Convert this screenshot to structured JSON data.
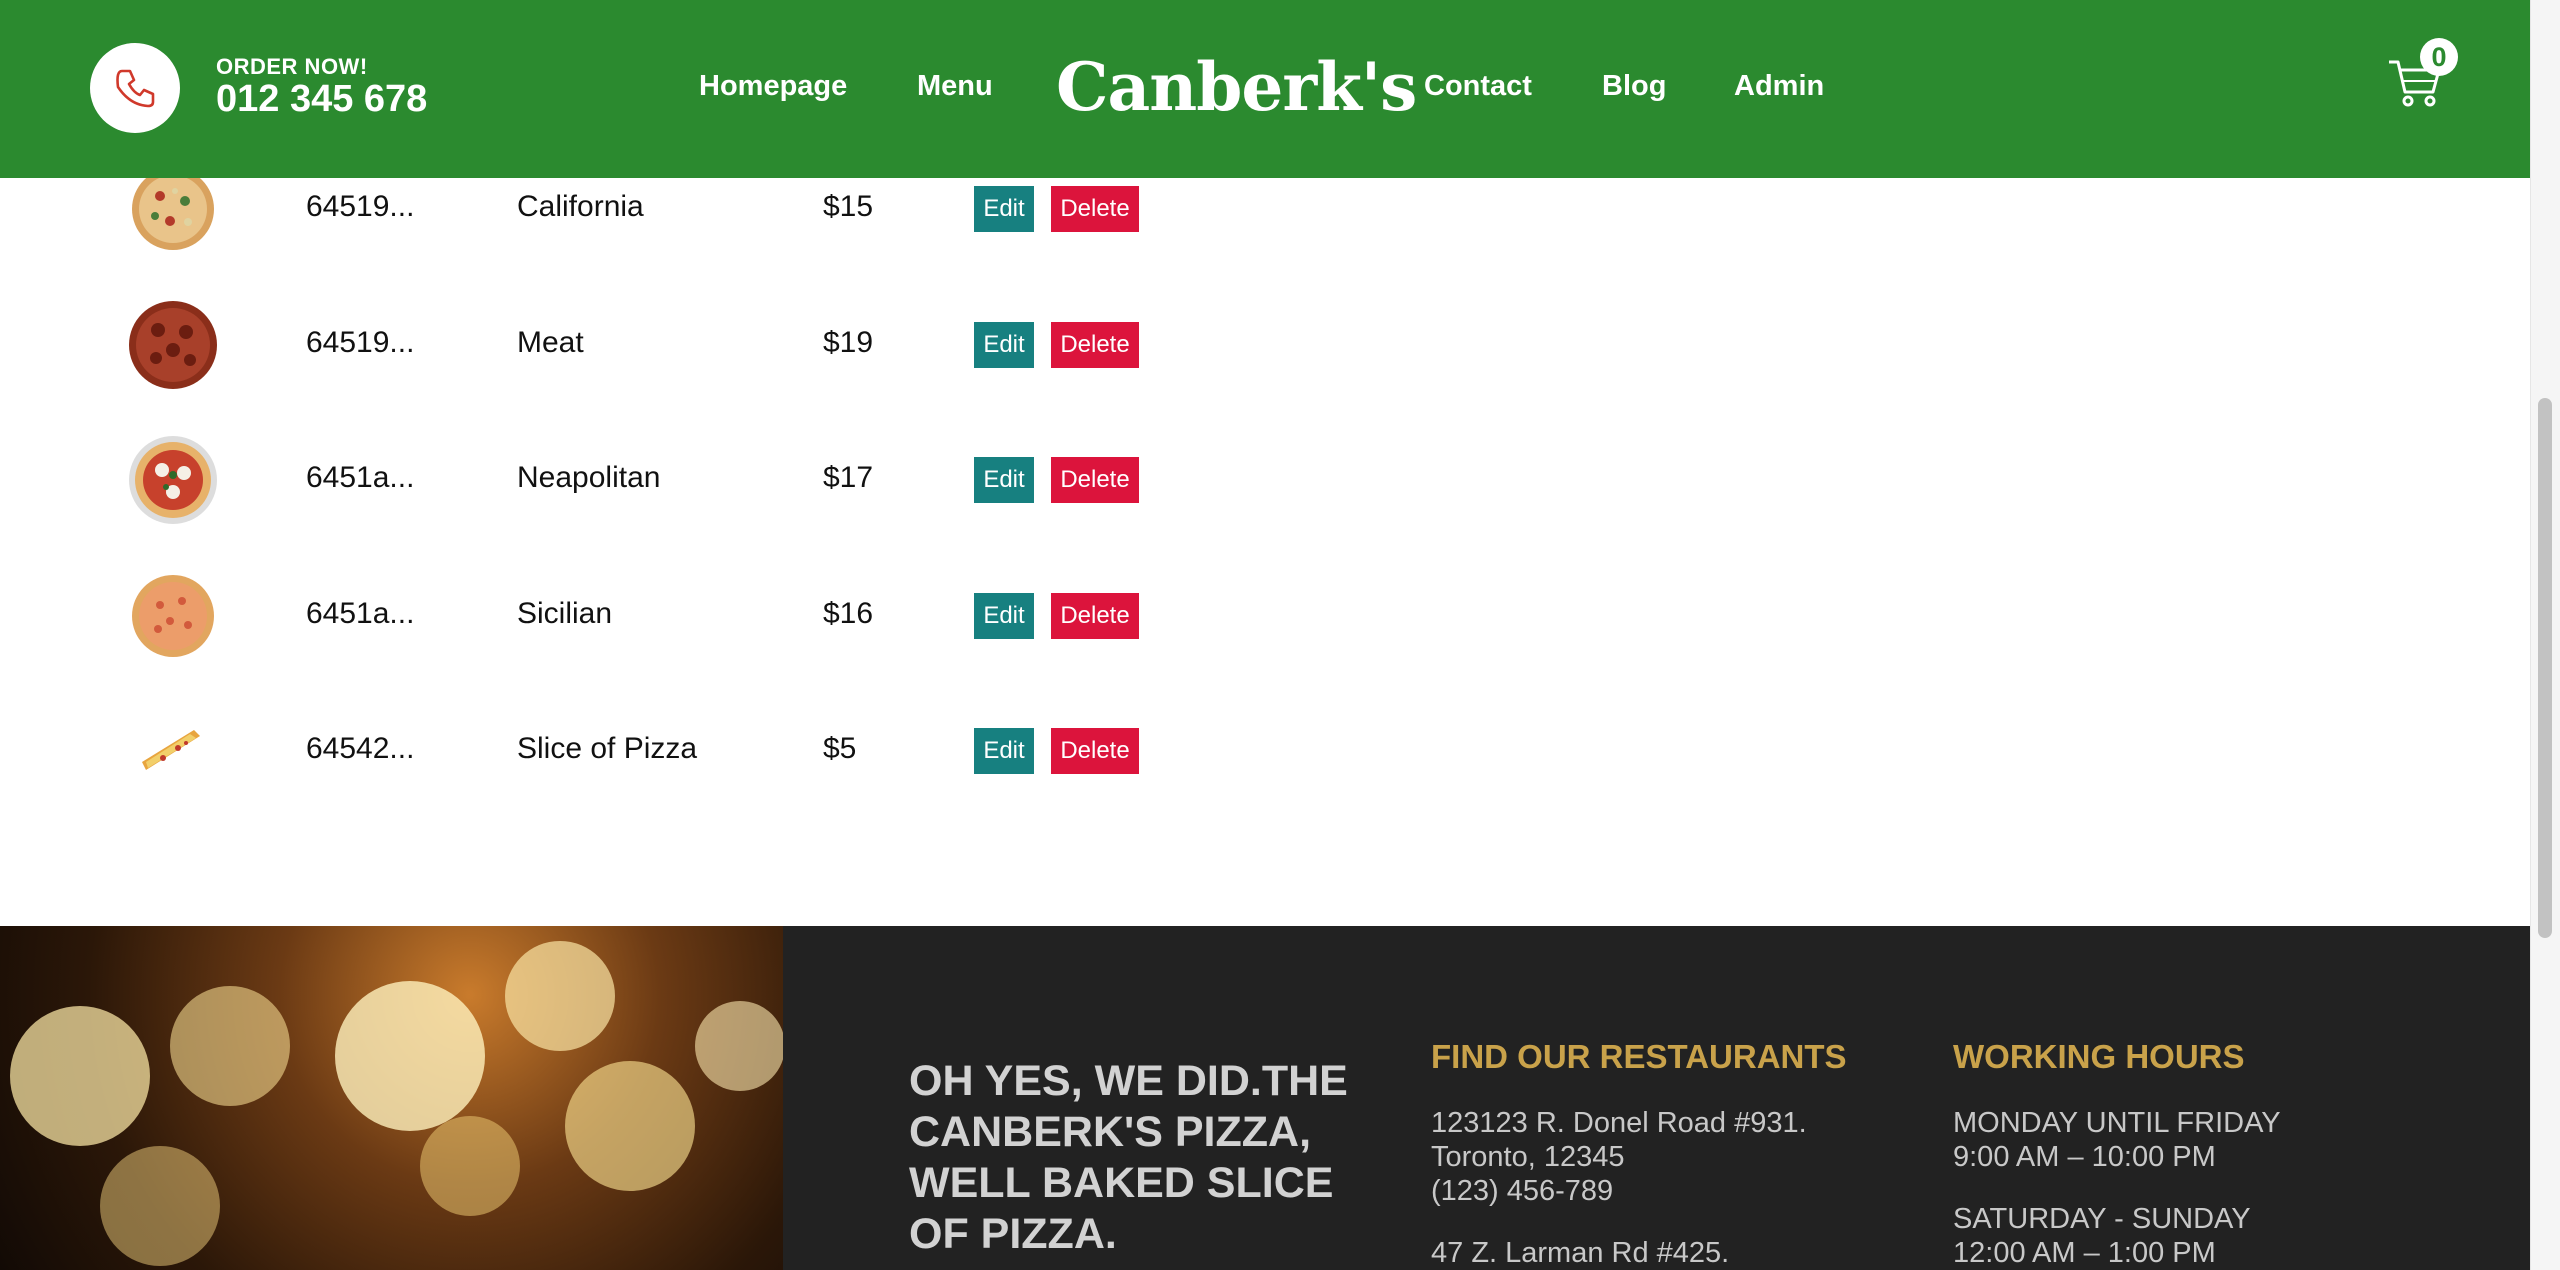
{
  "nav": {
    "order_label": "ORDER NOW!",
    "phone": "012 345 678",
    "brand": "Canberk's",
    "links": [
      "Homepage",
      "Menu",
      "Contact",
      "Blog",
      "Admin"
    ],
    "cart_count": "0",
    "phone_icon": "phone-icon",
    "cart_icon": "cart-icon"
  },
  "products": [
    {
      "id": "64519...",
      "name": "California",
      "price": "$15",
      "edit": "Edit",
      "delete": "Delete",
      "image": "pizza-california"
    },
    {
      "id": "64519...",
      "name": "Meat",
      "price": "$19",
      "edit": "Edit",
      "delete": "Delete",
      "image": "pizza-meat"
    },
    {
      "id": "6451a...",
      "name": "Neapolitan",
      "price": "$17",
      "edit": "Edit",
      "delete": "Delete",
      "image": "pizza-neapolitan"
    },
    {
      "id": "6451a...",
      "name": "Sicilian",
      "price": "$16",
      "edit": "Edit",
      "delete": "Delete",
      "image": "pizza-sicilian"
    },
    {
      "id": "64542...",
      "name": "Slice of Pizza",
      "price": "$5",
      "edit": "Edit",
      "delete": "Delete",
      "image": "pizza-slice"
    }
  ],
  "footer": {
    "slogan": "OH YES, WE DID.THE CANBERK'S PIZZA, WELL BAKED SLICE OF PIZZA.",
    "restaurants": {
      "heading": "FIND OUR RESTAURANTS",
      "address1_line1": "123123 R. Donel Road #931.",
      "address1_line2": "Toronto, 12345",
      "address1_phone": "(123) 456-789",
      "address2_line1": "47 Z. Larman Rd #425."
    },
    "hours": {
      "heading": "WORKING HOURS",
      "weekday_label": "MONDAY UNTIL FRIDAY",
      "weekday_hours": "9:00 AM – 10:00 PM",
      "weekend_label": "SATURDAY - SUNDAY",
      "weekend_hours": "12:00 AM – 1:00 PM"
    }
  },
  "colors": {
    "nav_green": "#2b8a2f",
    "edit_teal": "#178080",
    "delete_red": "#dc143c",
    "footer_dark": "#222222",
    "footer_gold": "#c9a24a"
  }
}
